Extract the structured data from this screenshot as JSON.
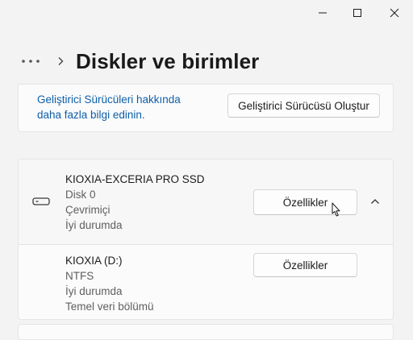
{
  "window": {
    "minimize_icon": "minimize-icon",
    "maximize_icon": "maximize-icon",
    "close_icon": "close-icon"
  },
  "header": {
    "title": "Diskler ve birimler",
    "more_icon": "more-horizontal-icon",
    "chevron_icon": "chevron-right-icon"
  },
  "developer": {
    "link_text": "Geliştirici Sürücüleri hakkında daha fazla bilgi edinin.",
    "button_label": "Geliştirici Sürücüsü Oluştur"
  },
  "disk": {
    "icon": "hard-drive-icon",
    "name": "KIOXIA-EXCERIA PRO SSD",
    "number": "Disk 0",
    "status": "Çevrimiçi",
    "health": "İyi durumda",
    "properties_label": "Özellikler",
    "collapse_icon": "chevron-up-icon"
  },
  "volume": {
    "name": "KIOXIA (D:)",
    "filesystem": "NTFS",
    "health": "İyi durumda",
    "type": "Temel veri bölümü",
    "properties_label": "Özellikler"
  },
  "colors": {
    "background": "#f3f3f3",
    "card": "#fbfbfb",
    "link": "#0d5fa8"
  }
}
